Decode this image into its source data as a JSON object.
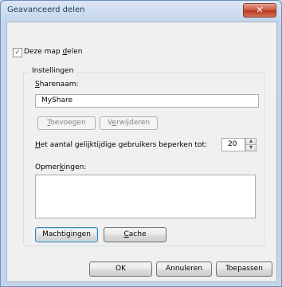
{
  "window": {
    "title": "Geavanceerd delen",
    "close_glyph": "✕"
  },
  "share_checkbox": {
    "checked_glyph": "✓",
    "label_pre": "Deze map ",
    "label_accel": "d",
    "label_post": "elen"
  },
  "group": {
    "legend": "Instellingen"
  },
  "sharename": {
    "label_accel": "S",
    "label_rest": "harenaam:",
    "value": "MyShare"
  },
  "buttons": {
    "add": {
      "accel": "T",
      "rest": "oevoegen"
    },
    "remove": {
      "pre": "V",
      "accel": "e",
      "post": "rwijderen"
    },
    "permissions": {
      "label": "Machtigingen"
    },
    "cache": {
      "accel": "C",
      "rest": "ache"
    },
    "ok": "OK",
    "cancel": "Annuleren",
    "apply": "Toepassen"
  },
  "limit": {
    "label_accel": "H",
    "label_rest": "et aantal gelijktijdige gebruikers beperken tot:",
    "value": "20",
    "up": "▲",
    "down": "▼"
  },
  "comments": {
    "label_pre": "Opmer",
    "label_accel": "k",
    "label_post": "ingen:",
    "value": ""
  }
}
